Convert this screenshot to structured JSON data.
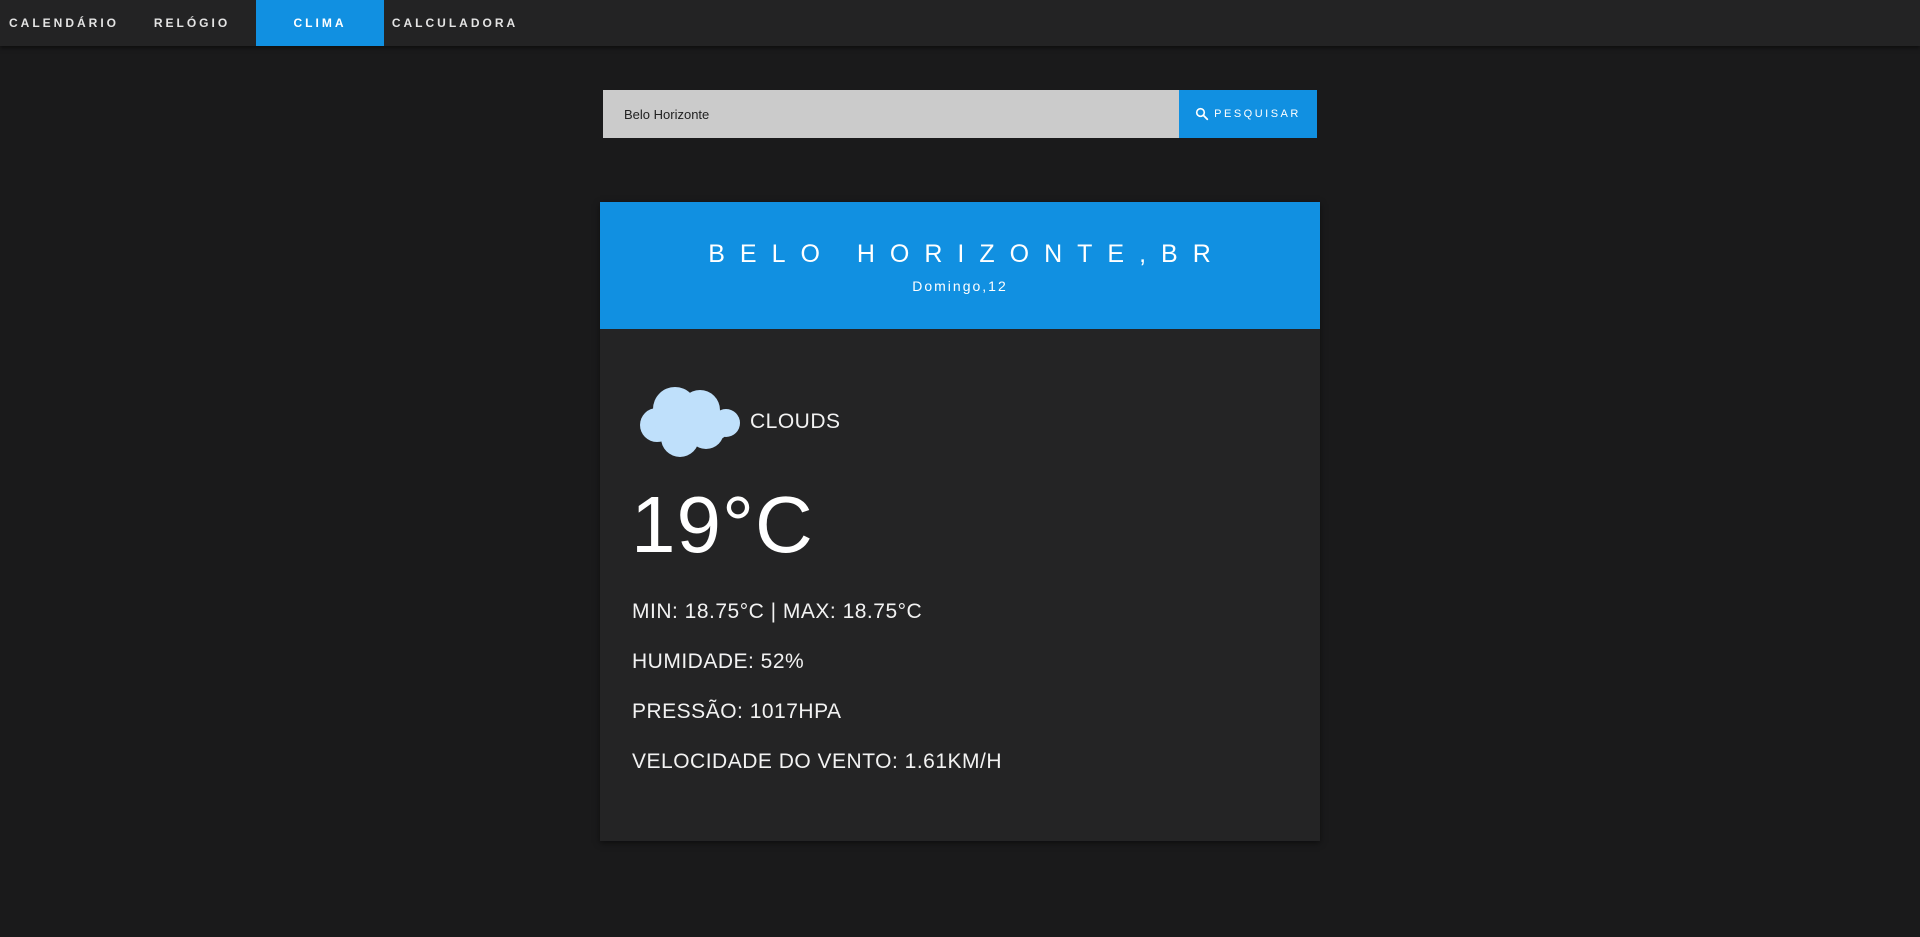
{
  "nav": {
    "tabs": [
      {
        "label": "CALENDÁRIO"
      },
      {
        "label": "RELÓGIO"
      },
      {
        "label": "CLIMA",
        "active": true
      },
      {
        "label": "CALCULADORA"
      }
    ]
  },
  "search": {
    "value": "Belo Horizonte",
    "button_label": "PESQUISAR",
    "button_icon": "search-icon"
  },
  "weather": {
    "city": "BELO HORIZONTE,BR",
    "date": "Domingo,12",
    "condition_icon": "cloud-icon",
    "condition": "CLOUDS",
    "temperature": "19°C",
    "min_max": "MIN: 18.75°C | MAX: 18.75°C",
    "humidity": "HUMIDADE: 52%",
    "pressure": "PRESSÃO: 1017HPA",
    "wind": "VELOCIDADE DO VENTO: 1.61KM/H"
  },
  "colors": {
    "accent": "#1190e1",
    "background": "#1a1a1b",
    "nav_background": "#232324",
    "card_background": "#242425",
    "cloud": "#bfe0fb",
    "search_field": "#cbcbcb"
  }
}
